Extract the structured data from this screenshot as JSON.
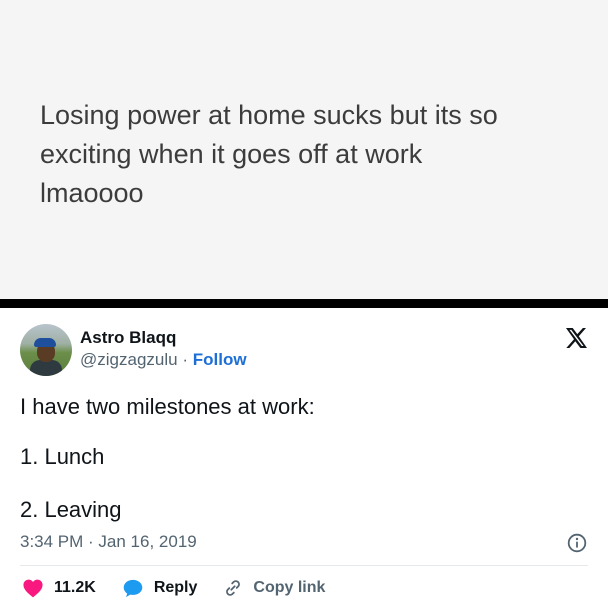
{
  "top_post": {
    "text": "Losing power at home sucks but its so\nexciting when it goes off at work\nlmaoooo"
  },
  "tweet": {
    "display_name": "Astro Blaqq",
    "handle": "@zigzagzulu",
    "separator": "·",
    "follow_label": "Follow",
    "lines": [
      "I have two milestones at work:",
      "1. Lunch",
      "2. Leaving"
    ],
    "timestamp": "3:34 PM · Jan 16, 2019",
    "like_count": "11.2K",
    "reply_label": "Reply",
    "copy_link_label": "Copy link"
  },
  "colors": {
    "accent": "#1d6fd6",
    "like": "#f91880",
    "reply": "#1d9bf0",
    "muted": "#536471"
  },
  "icons": {
    "brand": "x-logo-icon",
    "info": "info-icon",
    "like": "heart-icon",
    "reply": "reply-bubble-icon",
    "link": "link-icon"
  }
}
